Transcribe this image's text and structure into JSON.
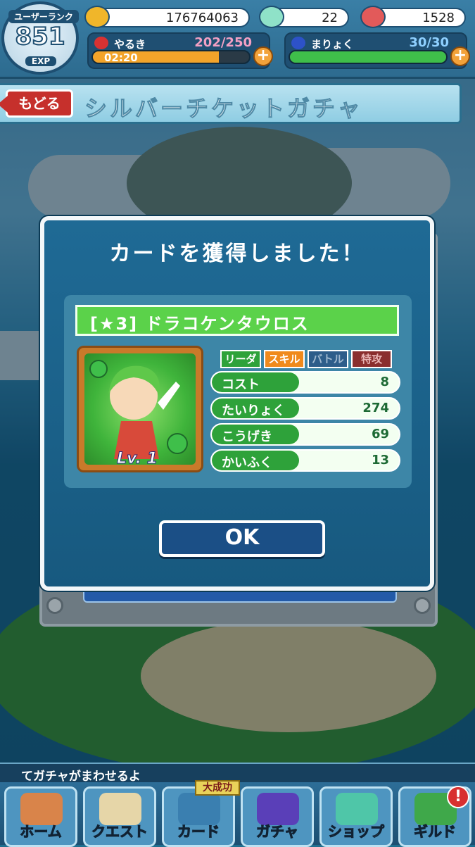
{
  "status": {
    "rank_label": "ユーザーランク",
    "rank_value": "851",
    "exp_label": "EXP",
    "coins": "176764063",
    "gems": "22",
    "points": "1528",
    "stamina": {
      "label": "やるき",
      "value": "202/250",
      "timer": "02:20",
      "fill": 0.808
    },
    "mana": {
      "label": "まりょく",
      "value": "30/30",
      "fill": 1.0
    }
  },
  "header": {
    "back_label": "もどる",
    "title": "シルバーチケットガチャ"
  },
  "modal": {
    "title": "カードを獲得しました！",
    "card_name": "[★3] ドラコケンタウロス",
    "level": "Lv. 1",
    "tags": [
      "リーダー",
      "スキル",
      "バトル",
      "特攻"
    ],
    "stats": [
      {
        "label": "コスト",
        "value": "8"
      },
      {
        "label": "たいりょく",
        "value": "274"
      },
      {
        "label": "こうげき",
        "value": "69"
      },
      {
        "label": "かいふく",
        "value": "13"
      }
    ],
    "ok_label": "OK"
  },
  "ticker": "てガチャがまわせるよ",
  "nav": {
    "items": [
      {
        "label": "ホーム",
        "icon": "house-icon"
      },
      {
        "label": "クエスト",
        "icon": "map-icon"
      },
      {
        "label": "カード",
        "icon": "card-icon",
        "sticker": "大成功"
      },
      {
        "label": "ガチャ",
        "icon": "gacha-icon"
      },
      {
        "label": "ショップ",
        "icon": "gem-shop-icon"
      },
      {
        "label": "ギルド",
        "icon": "guild-icon",
        "badge": "!"
      }
    ]
  },
  "colors": {
    "accent_green": "#5bd24a",
    "stat_green": "#2ea23a",
    "back_red": "#c6302c",
    "ok_blue": "#1b4f86"
  }
}
